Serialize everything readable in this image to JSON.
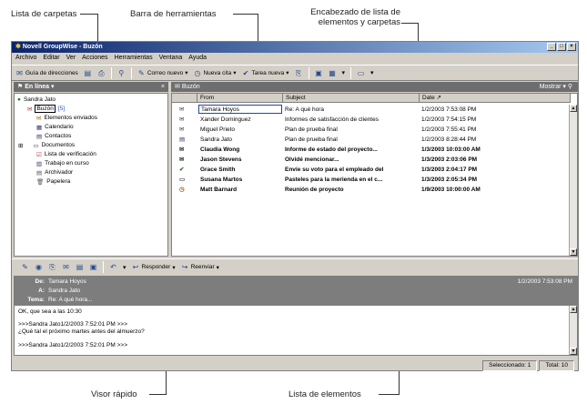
{
  "callouts": {
    "folders": "Lista de carpetas",
    "toolbar": "Barra de herramientas",
    "header_line1": "Encabezado de lista de",
    "header_line2": "elementos y carpetas",
    "quickviewer": "Visor rápido",
    "itemlist": "Lista de elementos"
  },
  "window": {
    "title": "Novell GroupWise - Buzón",
    "min": "_",
    "max": "□",
    "close": "×"
  },
  "menu": [
    "Archivo",
    "Editar",
    "Ver",
    "Acciones",
    "Herramientas",
    "Ventana",
    "Ayuda"
  ],
  "toolbar": {
    "address_book": "Guía de direcciones",
    "new_mail": "Correo nuevo",
    "new_appt": "Nueva cita",
    "new_task": "Tarea nueva"
  },
  "folder_header": {
    "online": "En línea",
    "close": "×"
  },
  "list_header": {
    "title": "Buzón",
    "show": "Mostrar"
  },
  "folders": [
    {
      "label": "Sandra Jato",
      "icon": "user-icon"
    },
    {
      "label": "Buzón",
      "count": "[5]",
      "icon": "mailbox-icon"
    },
    {
      "label": "Elementos enviados",
      "icon": "sent-icon"
    },
    {
      "label": "Calendario",
      "icon": "calendar-icon"
    },
    {
      "label": "Contactos",
      "icon": "contacts-icon"
    },
    {
      "label": "Documentos",
      "icon": "documents-icon"
    },
    {
      "label": "Lista de verificación",
      "icon": "checklist-icon"
    },
    {
      "label": "Trabajo en curso",
      "icon": "work-icon"
    },
    {
      "label": "Archivador",
      "icon": "cabinet-icon"
    },
    {
      "label": "Papelera",
      "icon": "trash-icon"
    }
  ],
  "columns": {
    "from": "From",
    "subject": "Subject",
    "date": "Date"
  },
  "items": [
    {
      "from": "Tamara Hoyos",
      "subject": "Re: A qué hora",
      "date": "1/2/2003 7:53:08 PM",
      "bold": false,
      "icon": "envelope-open-icon"
    },
    {
      "from": "Xander Dominguez",
      "subject": "Informes de satisfacción de clientes",
      "date": "1/2/2003 7:54:15 PM",
      "bold": false,
      "icon": "envelope-open-icon"
    },
    {
      "from": "Miguel Prieto",
      "subject": "Plan de prueba final",
      "date": "1/2/2003 7:55:41 PM",
      "bold": false,
      "icon": "envelope-open-icon"
    },
    {
      "from": "Sandra Jato",
      "subject": "Plan de prueba final",
      "date": "1/2/2003 8:28:44 PM",
      "bold": false,
      "icon": "document-icon"
    },
    {
      "from": "Claudia Wong",
      "subject": "Informe de estado del proyecto...",
      "date": "1/3/2003 10:03:00 AM",
      "bold": true,
      "icon": "envelope-icon"
    },
    {
      "from": "Jason Stevens",
      "subject": "Olvidé mencionar...",
      "date": "1/3/2003 2:03:06 PM",
      "bold": true,
      "icon": "envelope-icon"
    },
    {
      "from": "Grace Smith",
      "subject": "Envíe su voto para el empleado del",
      "date": "1/3/2003 2:04:17 PM",
      "bold": true,
      "icon": "task-icon"
    },
    {
      "from": "Susana Martos",
      "subject": "Pasteles para la merienda en el c...",
      "date": "1/3/2003 2:05:34 PM",
      "bold": true,
      "icon": "note-icon"
    },
    {
      "from": "Matt Barnard",
      "subject": "Reunión de proyecto",
      "date": "1/9/2003 10:00:00 AM",
      "bold": true,
      "icon": "appointment-icon"
    }
  ],
  "quickbar": {
    "reply": "Responder",
    "forward": "Reenviar"
  },
  "preview": {
    "from_label": "De:",
    "from": "Tamara Hoyos",
    "to_label": "A:",
    "to": "Sandra Jato",
    "subject_label": "Tema:",
    "subject": "Re: A qué hora...",
    "date": "1/2/2003 7:53:08 PM",
    "body1": "OK, que sea a las 10:30",
    "body2": ">>>Sandra Jato1/2/2003 7:52:01 PM >>>",
    "body3": "¿Qué tal el próximo martes antes del almuerzo?",
    "body4": ">>>Sandra Jato1/2/2003 7:52:01 PM >>>"
  },
  "status": {
    "selected": "Seleccionado: 1",
    "total": "Total: 10"
  }
}
